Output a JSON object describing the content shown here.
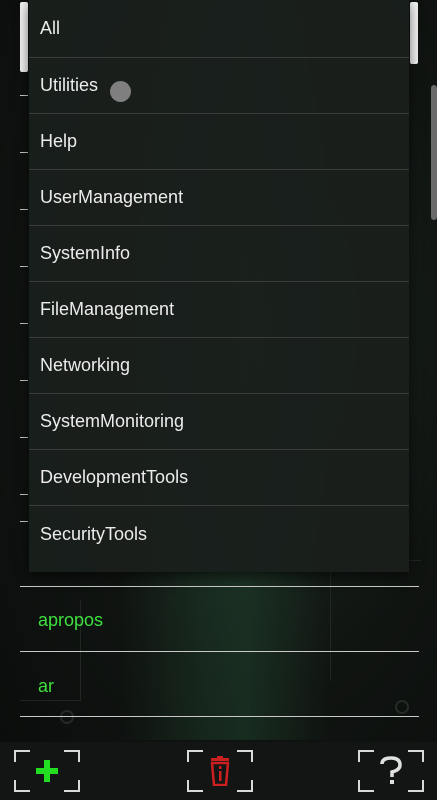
{
  "dropdown": {
    "selected_index": 0,
    "items": [
      {
        "label": "All"
      },
      {
        "label": "Utilities"
      },
      {
        "label": "Help"
      },
      {
        "label": "UserManagement"
      },
      {
        "label": "SystemInfo"
      },
      {
        "label": "FileManagement"
      },
      {
        "label": "Networking"
      },
      {
        "label": "SystemMonitoring"
      },
      {
        "label": "DevelopmentTools"
      },
      {
        "label": "SecurityTools"
      }
    ]
  },
  "command_list": {
    "items": [
      {
        "label": "apropos"
      },
      {
        "label": "ar"
      }
    ]
  },
  "toolbar": {
    "add_icon": "plus-icon",
    "delete_icon": "trash-icon",
    "help_icon": "question-icon"
  },
  "colors": {
    "command_text": "#3ee03e",
    "add_icon": "#22dd22",
    "delete_icon": "#cc1f1f",
    "dropdown_text": "#ececec"
  }
}
